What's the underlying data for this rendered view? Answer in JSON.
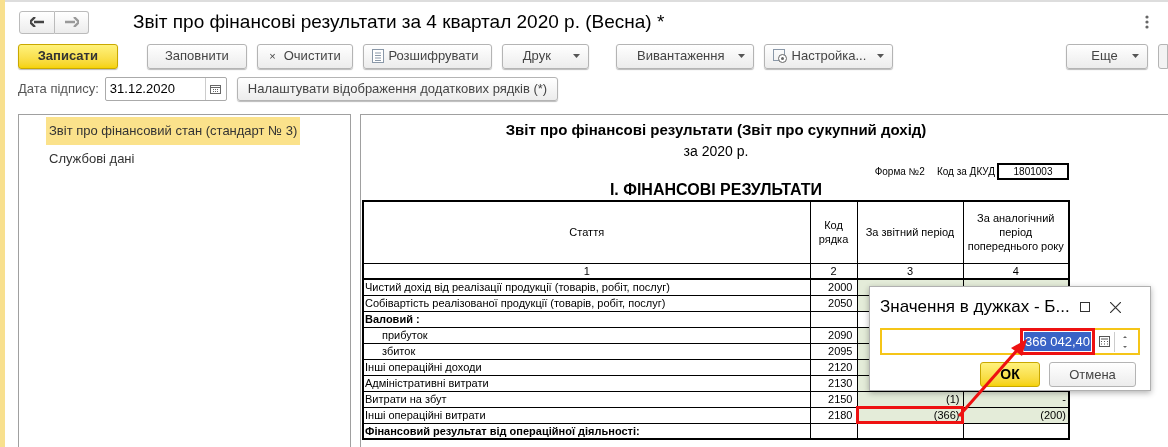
{
  "window": {
    "title": "Звіт про фінансові результати за 4 квартал 2020 р. (Весна) *"
  },
  "toolbar": [
    {
      "label": "Записати",
      "kind": "primary"
    },
    {
      "label": "Заповнити",
      "kind": "plain"
    },
    {
      "label": "Очистити",
      "kind": "clear",
      "icon_text": "×"
    },
    {
      "label": "Розшифрувати",
      "kind": "document"
    },
    {
      "label": "Друк",
      "kind": "dropdown"
    },
    {
      "label": "Вивантаження",
      "kind": "dropdown"
    },
    {
      "label": "Настройка...",
      "kind": "settings"
    },
    {
      "label": "Еще",
      "kind": "more"
    }
  ],
  "signature": {
    "label": "Дата підпису:",
    "value": "31.12.2020",
    "button": "Налаштувати відображення додаткових рядків (*)"
  },
  "sidebar": {
    "items": [
      {
        "label": "Звіт про фінансовий стан (стандарт № 3)",
        "selected": true
      },
      {
        "label": "Службові дані",
        "selected": false
      }
    ]
  },
  "report": {
    "title": "Звіт про фінансові результати (Звіт про сукупний дохід)",
    "period": "за 2020 р.",
    "form": "Форма №2",
    "dkud_label": "Код за ДКУД",
    "dkud": "1801003",
    "section": "І. ФІНАНСОВІ РЕЗУЛЬТАТИ",
    "columns": [
      "Стаття",
      "Код рядка",
      "За звітний період",
      "За аналогічний період попереднього року"
    ],
    "column_numbers": [
      "1",
      "2",
      "3",
      "4"
    ],
    "rows": [
      {
        "label": "Чистий дохід від реалізації продукції (товарів, робіт, послуг)",
        "code": "2000",
        "bold": false,
        "selected": false
      },
      {
        "label": "Собівартість реалізованої продукції (товарів, робіт, послуг)",
        "code": "2050",
        "bold": false,
        "selected": false
      },
      {
        "label": "Валовий :",
        "bold": true,
        "selected": false,
        "children": [
          {
            "label": "прибуток",
            "code": "2090",
            "bold": false,
            "selected": false
          },
          {
            "label": "збиток",
            "code": "2095",
            "bold": false,
            "selected": false
          }
        ]
      },
      {
        "label": "Інші операційні доходи",
        "code": "2120",
        "bold": false,
        "selected": false
      },
      {
        "label": "Адміністративні витрати",
        "code": "2130",
        "bold": false,
        "selected": false
      },
      {
        "label": "Витрати на збут",
        "code": "2150",
        "current": "(1)",
        "previous": "-",
        "bold": false,
        "selected": false
      },
      {
        "label": "Інші операційні витрати",
        "code": "2180",
        "current": "(366)",
        "previous": "(200)",
        "bold": false,
        "selected": true
      },
      {
        "label": "Фінансовий результат від операційної діяльності:",
        "bold": true,
        "selected": false
      }
    ]
  },
  "dialog": {
    "title": "Значення в дужках - Б...",
    "value": "366 042,40",
    "ok": "ОК",
    "cancel": "Отмена"
  }
}
